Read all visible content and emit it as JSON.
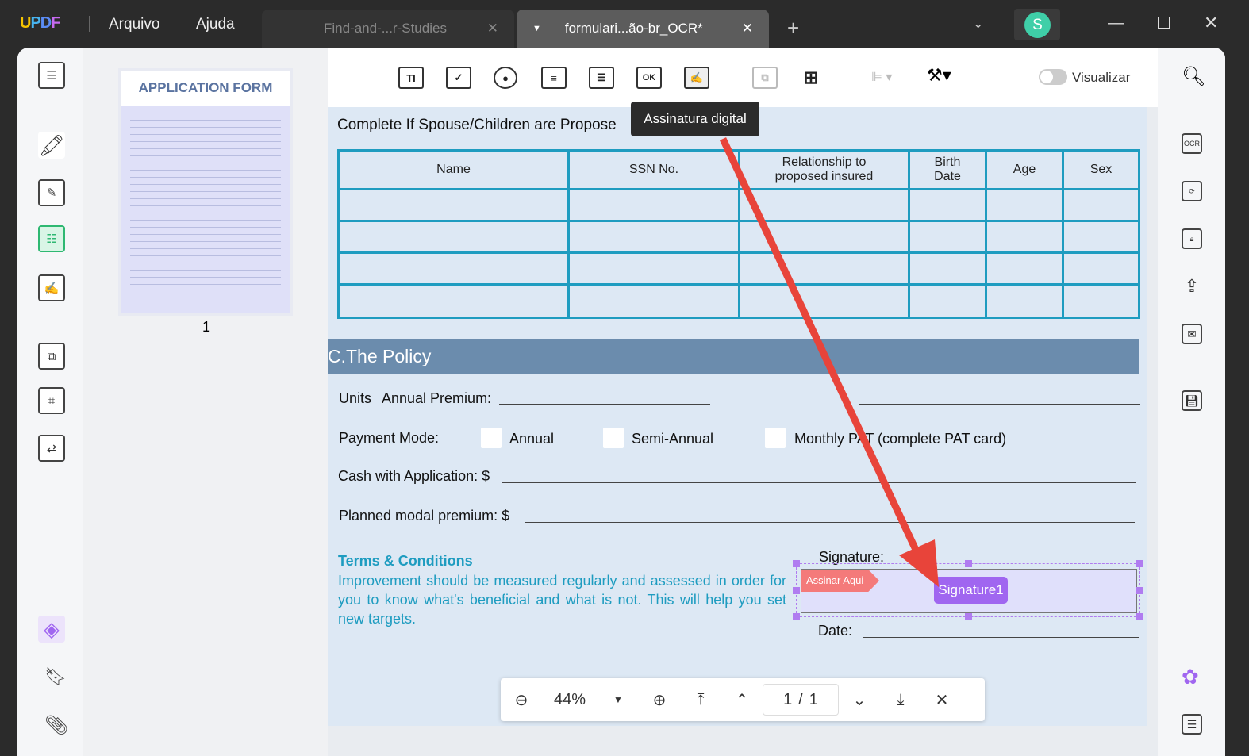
{
  "app": {
    "logo": "UPDF",
    "menu": [
      "Arquivo",
      "Ajuda"
    ],
    "avatar": "S"
  },
  "tabs": [
    {
      "label": "Find-and-...r-Studies"
    },
    {
      "label": "formulari...ão-br_OCR*"
    }
  ],
  "toolbar": {
    "tooltip": "Assinatura digital",
    "preview_label": "Visualizar",
    "text_tool": "TI",
    "ok_tool": "OK"
  },
  "thumbnail": {
    "title": "APPLICATION FORM",
    "page_number": "1"
  },
  "document": {
    "spouse_heading": "Complete If Spouse/Children are Propose",
    "table_headers": [
      "Name",
      "SSN No.",
      "Relationship to proposed insured",
      "Birth Date",
      "Age",
      "Sex"
    ],
    "row_count": 4,
    "policy_heading": "C.The Policy",
    "units_label": "Units",
    "annual_premium_label": "Annual Premium:",
    "payment_mode_label": "Payment Mode:",
    "payment_options": [
      "Annual",
      "Semi-Annual",
      "Monthly PAT (complete PAT card)"
    ],
    "cash_label": "Cash with Application: $",
    "planned_label": "Planned modal premium: $",
    "terms_title": "Terms & Conditions",
    "terms_text": "Improvement should be measured regularly and assessed in order for you to know what's beneficial and what is not. This will help you set new targets.",
    "signature_label": "Signature:",
    "sign_here": "Assinar Aqui",
    "signature_field": "Signature1",
    "date_label": "Date:"
  },
  "zoom": {
    "level": "44%",
    "page_current": "1",
    "page_sep": "/",
    "page_total": "1"
  },
  "colors": {
    "accent": "#1e9cc0",
    "signature": "#a066f0",
    "band": "#6b8cad",
    "arrow": "#e8443a"
  }
}
